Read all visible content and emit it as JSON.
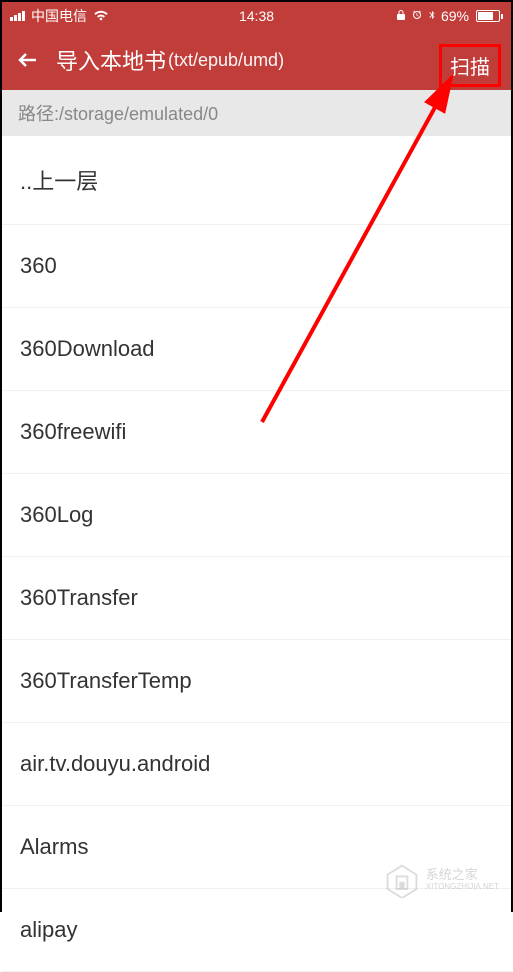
{
  "status_bar": {
    "carrier": "中国电信",
    "time": "14:38",
    "battery_percent": "69%"
  },
  "header": {
    "title": "导入本地书",
    "subtitle": "(txt/epub/umd)",
    "scan_label": "扫描"
  },
  "path_bar": {
    "label": "路径:/storage/emulated/0"
  },
  "file_list": [
    {
      "name": "..上一层"
    },
    {
      "name": "360"
    },
    {
      "name": "360Download"
    },
    {
      "name": "360freewifi"
    },
    {
      "name": "360Log"
    },
    {
      "name": "360Transfer"
    },
    {
      "name": "360TransferTemp"
    },
    {
      "name": "air.tv.douyu.android"
    },
    {
      "name": "Alarms"
    },
    {
      "name": "alipay"
    }
  ],
  "watermark": {
    "line1": "系统之家",
    "line2": "XITONGZHIJIA.NET"
  }
}
